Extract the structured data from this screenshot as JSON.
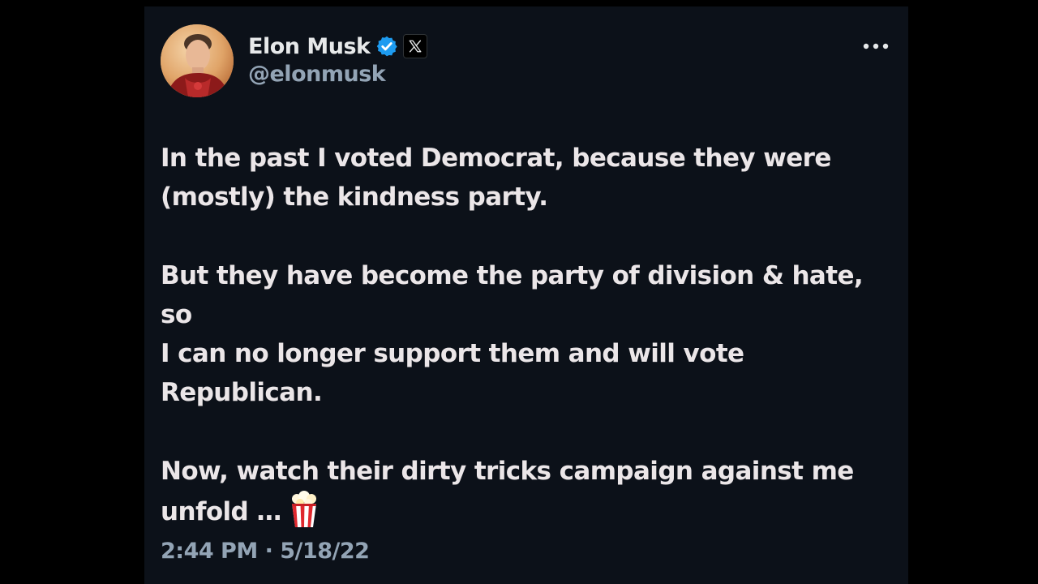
{
  "tweet": {
    "author": {
      "display_name": "Elon Musk",
      "handle": "@elonmusk",
      "verified_icon": "verified-badge-icon",
      "affiliation_icon": "x-logo-icon",
      "avatar": "profile-photo"
    },
    "menu_icon": "more-horizontal-icon",
    "paragraphs": [
      "In the past I voted Democrat, because they were\n(mostly) the kindness party.",
      "But they have become the party of division & hate, so\nI can no longer support them and will vote\nRepublican.",
      "Now, watch their dirty tricks campaign against me\nunfold …"
    ],
    "trailing_emoji": "popcorn-icon",
    "timestamp": "2:44 PM · 5/18/22"
  },
  "colors": {
    "background": "#000000",
    "card": "#0c1119",
    "text": "#ebe6e8",
    "secondary_text": "#93a4b5",
    "verified_blue": "#1d9bf0"
  }
}
